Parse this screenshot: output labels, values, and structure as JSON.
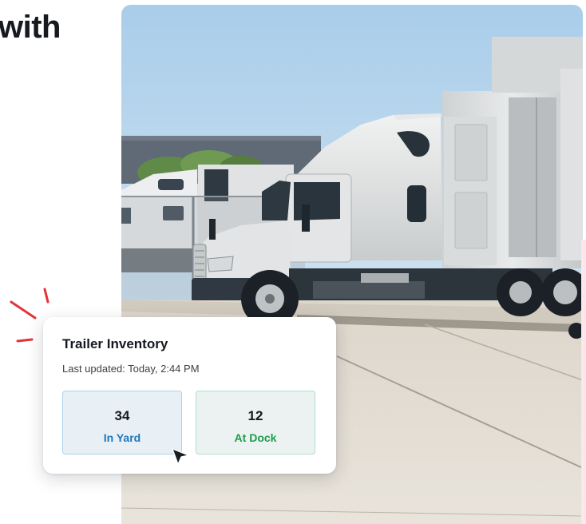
{
  "headline": {
    "fragment": "with"
  },
  "photo": {
    "subject": "truck-yard-photo"
  },
  "inventory_card": {
    "title": "Trailer Inventory",
    "last_updated": "Last updated: Today, 2:44 PM",
    "tiles": [
      {
        "count": "34",
        "label": "In Yard",
        "color": "#1d77bd"
      },
      {
        "count": "12",
        "label": "At Dock",
        "color": "#1c9e4a"
      }
    ]
  },
  "decor": {
    "spark_color": "#e3343b",
    "cursor_icon": "mouse-pointer-icon"
  }
}
